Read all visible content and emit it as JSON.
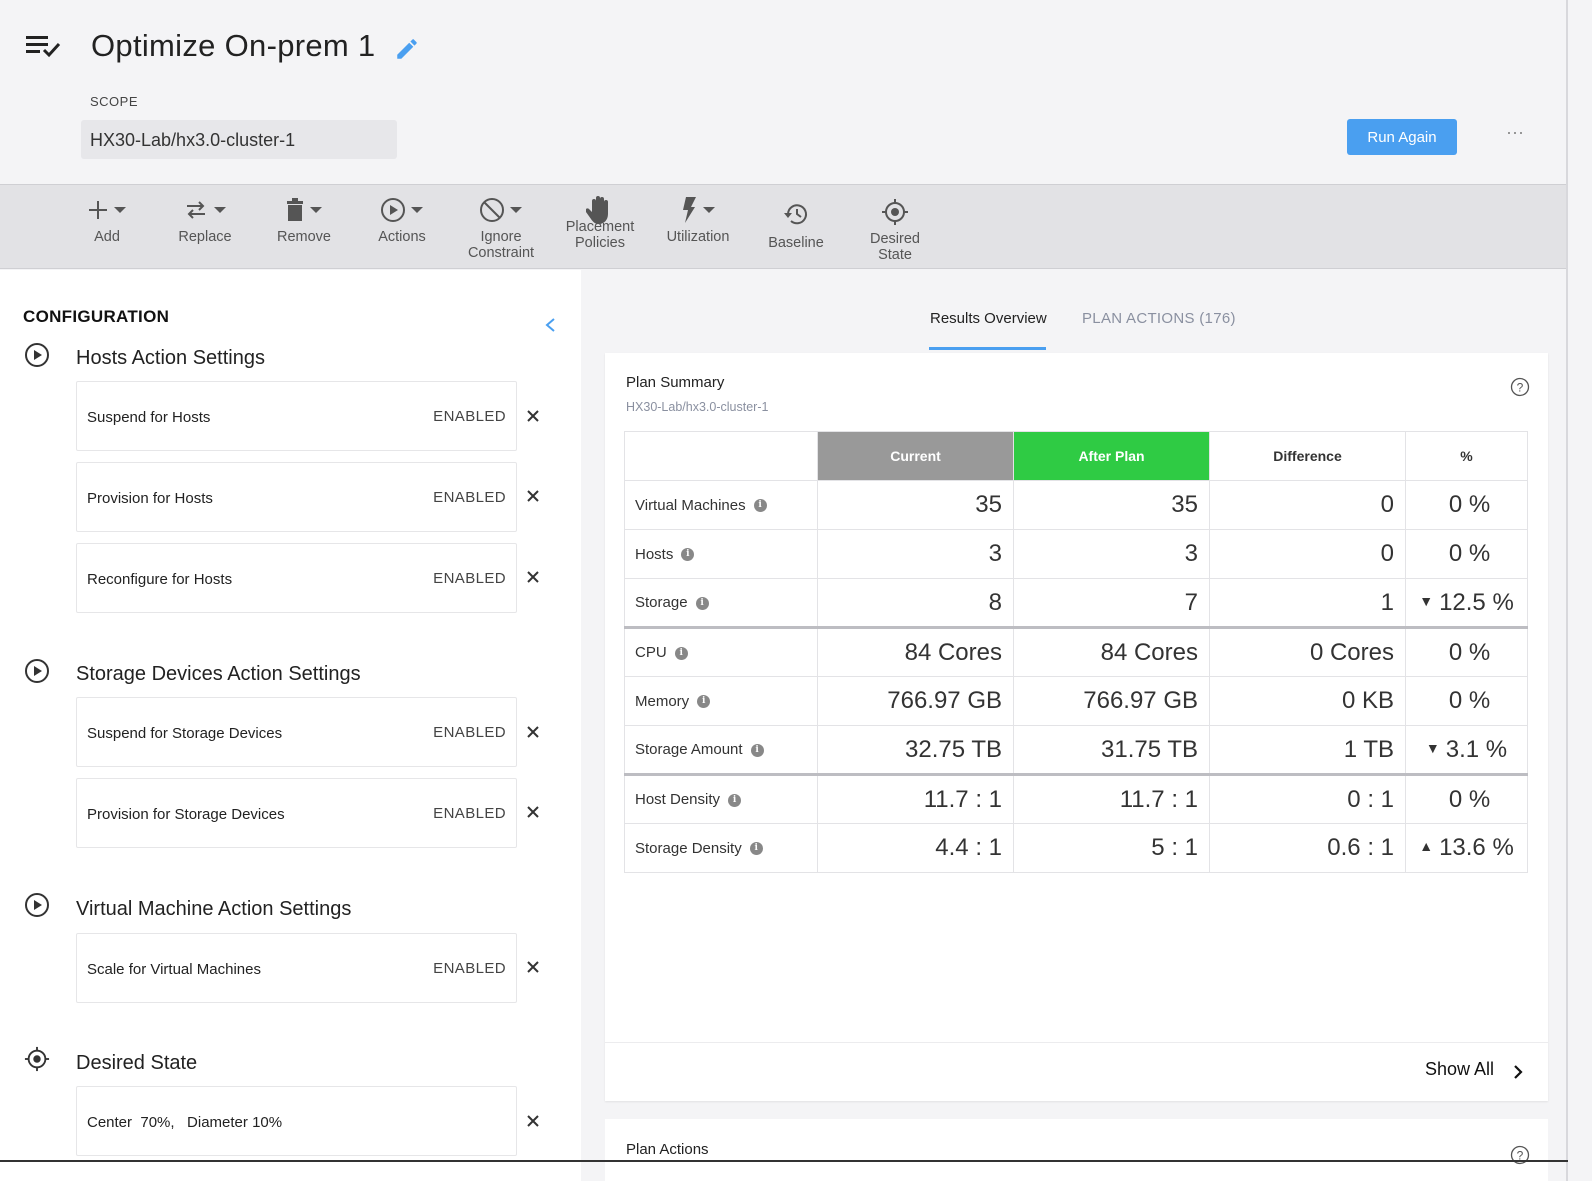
{
  "header": {
    "title": "Optimize On-prem 1",
    "scope_label": "SCOPE",
    "scope_value": "HX30-Lab/hx3.0-cluster-1",
    "run_button": "Run Again",
    "more_label": "···"
  },
  "toolbar": {
    "add": "Add",
    "replace": "Replace",
    "remove": "Remove",
    "actions": "Actions",
    "ignore_line1": "Ignore",
    "ignore_line2": "Constraint",
    "placement_line1": "Placement",
    "placement_line2": "Policies",
    "utilization": "Utilization",
    "baseline": "Baseline",
    "desired_line1": "Desired",
    "desired_line2": "State"
  },
  "configuration": {
    "title": "CONFIGURATION",
    "sections": [
      {
        "title": "Hosts Action Settings",
        "items": [
          {
            "name": "Suspend for Hosts",
            "state": "ENABLED"
          },
          {
            "name": "Provision for Hosts",
            "state": "ENABLED"
          },
          {
            "name": "Reconfigure for Hosts",
            "state": "ENABLED"
          }
        ]
      },
      {
        "title": "Storage Devices Action Settings",
        "items": [
          {
            "name": "Suspend for Storage Devices",
            "state": "ENABLED"
          },
          {
            "name": "Provision for Storage Devices",
            "state": "ENABLED"
          }
        ]
      },
      {
        "title": "Virtual Machine Action Settings",
        "items": [
          {
            "name": "Scale for Virtual Machines",
            "state": "ENABLED"
          }
        ]
      },
      {
        "title": "Desired State",
        "items": [
          {
            "name": "Center  70%,   Diameter 10%"
          }
        ]
      }
    ]
  },
  "tabs": {
    "active": "Results Overview",
    "inactive": "PLAN ACTIONS (176)"
  },
  "summary": {
    "title": "Plan Summary",
    "subtitle": "HX30-Lab/hx3.0-cluster-1",
    "headers": [
      "Current",
      "After Plan",
      "Difference",
      "%"
    ],
    "colors": {
      "current": "#999999",
      "after_plan": "#2fcb44"
    },
    "rows": [
      {
        "label": "Virtual Machines",
        "current": "35",
        "after": "35",
        "diff": "0",
        "pct": "0 %",
        "trend": ""
      },
      {
        "label": "Hosts",
        "current": "3",
        "after": "3",
        "diff": "0",
        "pct": "0 %",
        "trend": ""
      },
      {
        "label": "Storage",
        "current": "8",
        "after": "7",
        "diff": "1",
        "pct": "12.5 %",
        "trend": "▼"
      },
      {
        "label": "CPU",
        "current": "84 Cores",
        "after": "84 Cores",
        "diff": "0 Cores",
        "pct": "0 %",
        "trend": ""
      },
      {
        "label": "Memory",
        "current": "766.97 GB",
        "after": "766.97 GB",
        "diff": "0 KB",
        "pct": "0 %",
        "trend": ""
      },
      {
        "label": "Storage Amount",
        "current": "32.75 TB",
        "after": "31.75 TB",
        "diff": "1 TB",
        "pct": "3.1 %",
        "trend": "▼"
      },
      {
        "label": "Host Density",
        "current": "11.7 : 1",
        "after": "11.7 : 1",
        "diff": "0 : 1",
        "pct": "0 %",
        "trend": ""
      },
      {
        "label": "Storage Density",
        "current": "4.4 : 1",
        "after": "5 : 1",
        "diff": "0.6 : 1",
        "pct": "13.6 %",
        "trend": "▲"
      }
    ],
    "show_all": "Show All"
  },
  "plan_actions_card": {
    "title": "Plan Actions"
  },
  "icons": {
    "plan": "plan-list-check-icon",
    "edit": "pencil-icon",
    "help": "help-circle-icon",
    "info": "info-icon",
    "close": "close-icon"
  },
  "accent_color": "#4a9ff0"
}
